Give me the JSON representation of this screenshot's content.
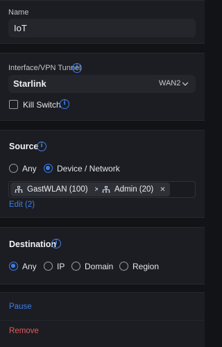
{
  "name_card": {
    "label": "Name",
    "value": "IoT"
  },
  "tunnel_card": {
    "label": "Interface/VPN Tunnel",
    "selected": "Starlink",
    "wan": "WAN2",
    "kill_switch_label": "Kill Switch",
    "kill_switch_checked": false
  },
  "source_card": {
    "title": "Source",
    "options": [
      "Any",
      "Device / Network"
    ],
    "selected_option": "Device / Network",
    "chips": [
      "GastWLAN (100)",
      "Admin (20)"
    ],
    "edit_label": "Edit (2)"
  },
  "destination_card": {
    "title": "Destination",
    "options": [
      "Any",
      "IP",
      "Domain",
      "Region"
    ],
    "selected_option": "Any"
  },
  "actions": {
    "pause_label": "Pause",
    "remove_label": "Remove"
  },
  "colors": {
    "accent": "#3d7eea",
    "danger": "#e05d5d",
    "card_bg": "#1c1d22",
    "page_bg": "#121316"
  }
}
